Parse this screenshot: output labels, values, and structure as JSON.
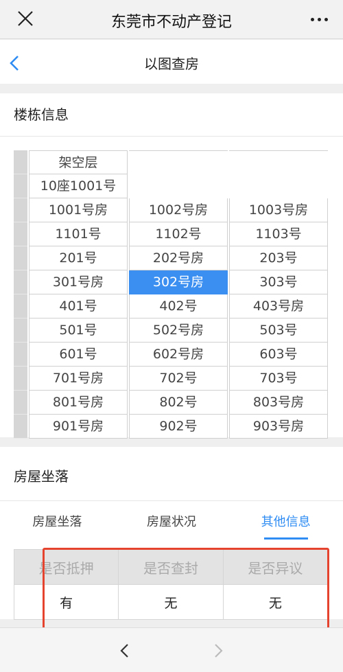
{
  "app": {
    "title": "东莞市不动产登记"
  },
  "nav": {
    "title": "以图查房"
  },
  "building": {
    "section_title": "楼栋信息",
    "header_rows": [
      [
        "架空层"
      ],
      [
        "10座1001号"
      ]
    ],
    "rows": [
      [
        "1001号房",
        "1002号房",
        "1003号房"
      ],
      [
        "1101号",
        "1102号",
        "1103号"
      ],
      [
        "201号",
        "202号房",
        "203号"
      ],
      [
        "301号房",
        "302号房",
        "303号"
      ],
      [
        "401号",
        "402号",
        "403号房"
      ],
      [
        "501号",
        "502号房",
        "503号"
      ],
      [
        "601号",
        "602号房",
        "603号"
      ],
      [
        "701号房",
        "702号",
        "703号"
      ],
      [
        "801号房",
        "802号",
        "803号房"
      ],
      [
        "901号房",
        "902号",
        "903号房"
      ]
    ],
    "selected": "302号房"
  },
  "house": {
    "section_title": "房屋坐落",
    "tabs": [
      "房屋坐落",
      "房屋状况",
      "其他信息"
    ],
    "active_tab": "其他信息",
    "table_headers": [
      "是否抵押",
      "是否查封",
      "是否异议"
    ],
    "table_values": [
      "有",
      "无",
      "无"
    ]
  },
  "colors": {
    "accent": "#2f8cf3",
    "highlight": "#e5432e"
  }
}
